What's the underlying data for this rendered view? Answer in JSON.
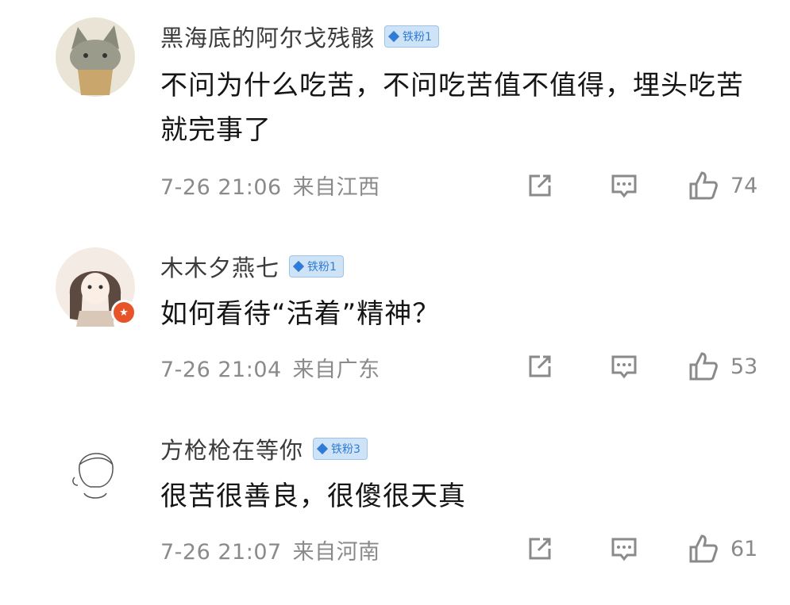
{
  "comments": [
    {
      "user": "黑海底的阿尔戈残骸",
      "fan_badge": "铁粉1",
      "text": "不问为什么吃苦，不问吃苦值不值得，埋头吃苦就完事了",
      "time": "7-26 21:06",
      "location": "来自江西",
      "likes": "74",
      "avatar_icon": "cat-avatar-icon"
    },
    {
      "user": "木木夕燕七",
      "fan_badge": "铁粉1",
      "text": "如何看待“活着”精神？",
      "time": "7-26 21:04",
      "location": "来自广东",
      "likes": "53",
      "avatar_icon": "anime-girl-avatar-icon"
    },
    {
      "user": "方枪枪在等你",
      "fan_badge": "铁粉3",
      "text": "很苦很善良，很傻很天真",
      "time": "7-26 21:07",
      "location": "来自河南",
      "likes": "61",
      "avatar_icon": "sketch-avatar-icon"
    }
  ],
  "colors": {
    "badge_bg": "#cfe3f7",
    "badge_text": "#2f7bd6",
    "meta_text": "#8a8a8a",
    "star_badge": "#e8542a"
  },
  "icons": [
    "share-icon",
    "reply-icon",
    "thumbs-up-icon"
  ]
}
